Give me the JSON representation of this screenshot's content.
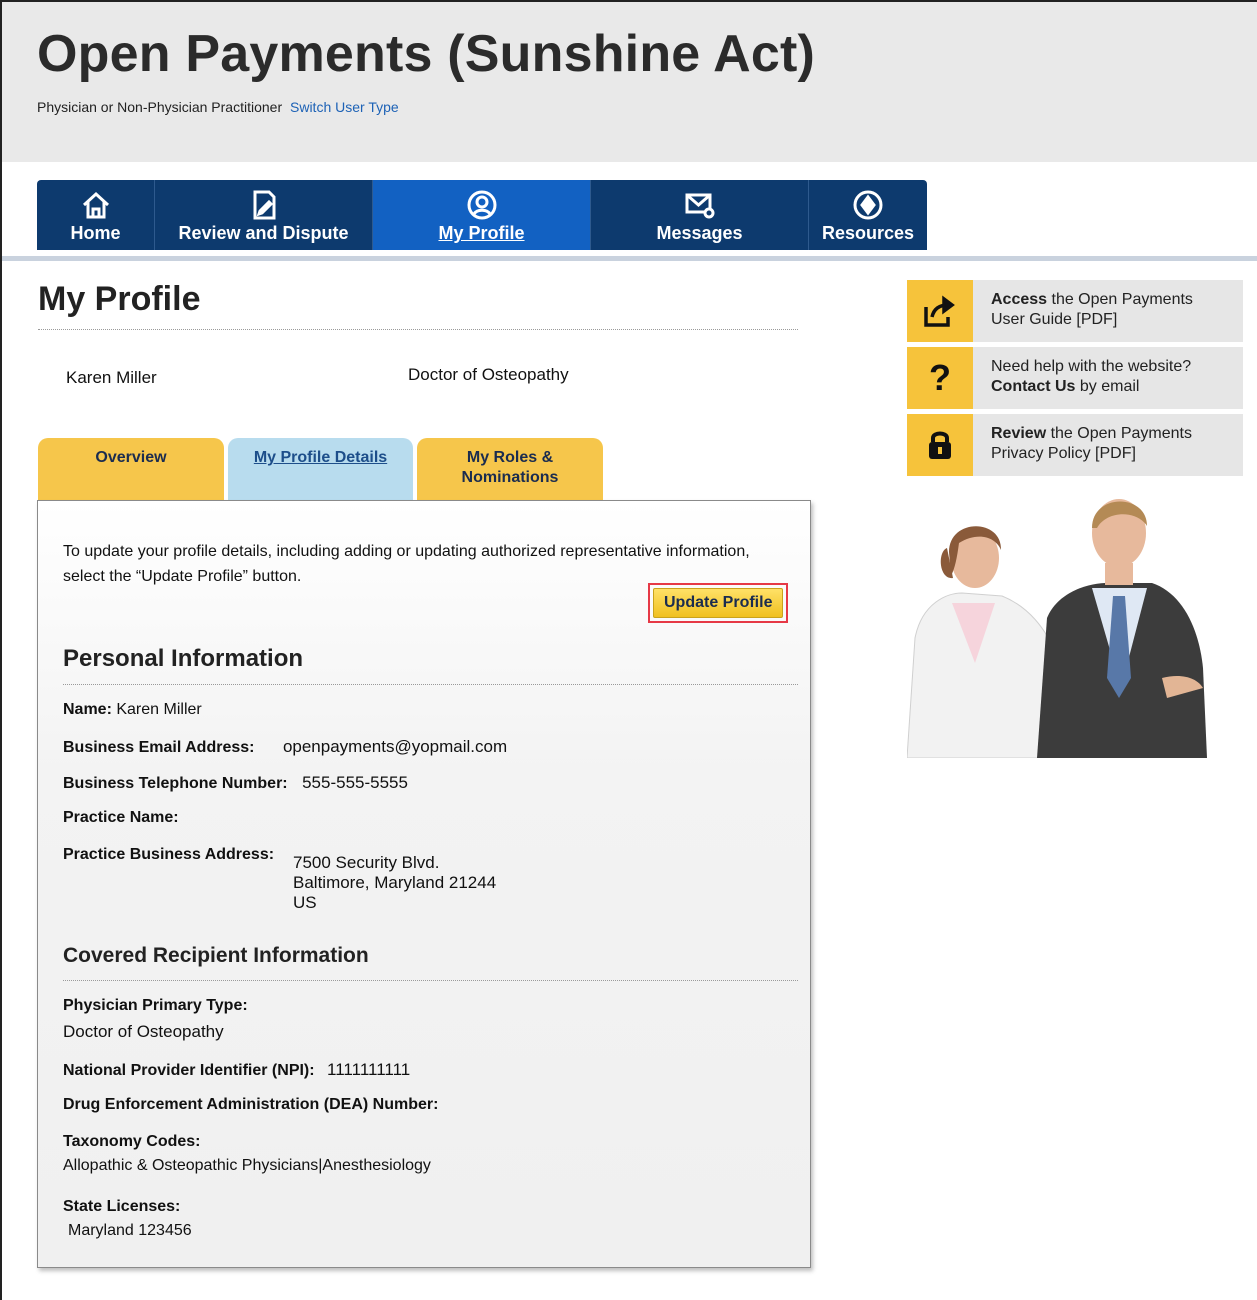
{
  "header": {
    "title": "Open Payments (Sunshine Act)",
    "user_type": "Physician or Non-Physician Practitioner",
    "switch_link": "Switch User Type"
  },
  "nav": [
    {
      "label": "Home",
      "icon": "home-icon"
    },
    {
      "label": "Review and Dispute",
      "icon": "edit-document-icon"
    },
    {
      "label": "My Profile",
      "icon": "user-circle-icon"
    },
    {
      "label": "Messages",
      "icon": "envelope-icon"
    },
    {
      "label": "Resources",
      "icon": "resources-icon"
    }
  ],
  "page": {
    "title": "My Profile",
    "name": "Karen Miller",
    "type": "Doctor of Osteopathy"
  },
  "tabs": [
    {
      "label": "Overview"
    },
    {
      "label": "My Profile Details"
    },
    {
      "label": "My Roles &",
      "label2": "Nominations"
    }
  ],
  "panel": {
    "intro": "To update your profile details, including adding or updating authorized representative information, select the “Update Profile” button.",
    "update_button": "Update Profile",
    "personal": {
      "heading": "Personal Information",
      "name_label": "Name:",
      "name_value": "Karen Miller",
      "email_label": "Business Email Address:",
      "email_value": "openpayments@yopmail.com",
      "phone_label": "Business Telephone Number:",
      "phone_value": "555-555-5555",
      "practice_label": "Practice Name:",
      "address_label": "Practice Business Address:",
      "address_line1": "7500 Security Blvd.",
      "address_line2": "Baltimore, Maryland 21244",
      "address_line3": "US"
    },
    "covered": {
      "heading": "Covered Recipient Information",
      "primary_type_label": "Physician Primary Type:",
      "primary_type_value": "Doctor of Osteopathy",
      "npi_label": "National Provider Identifier (NPI):",
      "npi_value": "1111111111",
      "dea_label": "Drug Enforcement Administration (DEA) Number:",
      "taxonomy_label": "Taxonomy Codes:",
      "taxonomy_value": "Allopathic & Osteopathic Physicians|Anesthesiology",
      "licenses_label": "State Licenses:",
      "licenses_value": "Maryland 123456"
    }
  },
  "sidebar": {
    "links": [
      {
        "bold": "Access",
        "rest": " the Open Payments",
        "line2": "User Guide [PDF]",
        "icon": "share-icon"
      },
      {
        "line1": "Need help with the website?",
        "bold": "Contact Us",
        "rest": " by email",
        "icon": "question-icon"
      },
      {
        "bold": "Review",
        "rest": " the Open Payments",
        "line2": "Privacy Policy [PDF]",
        "icon": "lock-icon"
      }
    ]
  },
  "colors": {
    "nav_bg": "#0d3a6e",
    "nav_active": "#1261c2",
    "tab_yellow": "#f6c64b",
    "tab_active": "#b8dcee",
    "highlight_border": "#e63946"
  }
}
